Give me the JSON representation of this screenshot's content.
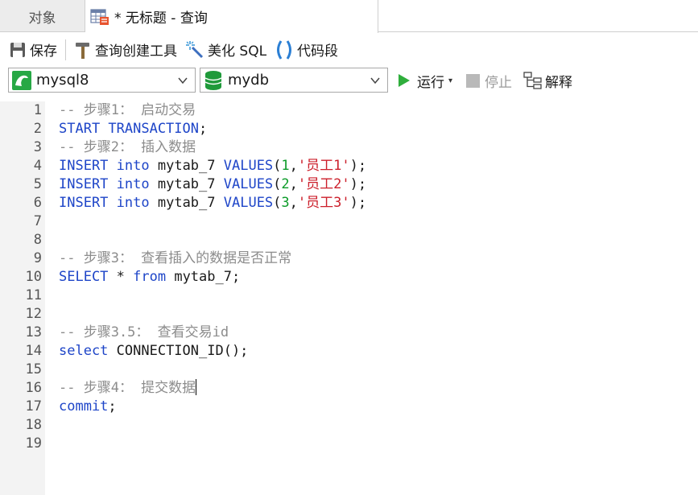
{
  "tabs": {
    "objects_label": "对象",
    "query_label": "* 无标题 - 查询"
  },
  "toolbar": {
    "save_label": "保存",
    "query_builder_label": "查询创建工具",
    "beautify_label": "美化 SQL",
    "snippet_label": "代码段"
  },
  "connection": {
    "selected": "mysql8"
  },
  "database": {
    "selected": "mydb"
  },
  "actions": {
    "run_label": "运行",
    "stop_label": "停止",
    "explain_label": "解释"
  },
  "colors": {
    "keyword": "#1e45c8",
    "comment": "#8c8c8c",
    "number": "#0b9b28",
    "string": "#cc1f2b",
    "run_green": "#2fae3c",
    "db_green": "#1f9a3a"
  },
  "editor": {
    "line_numbers": [
      "1",
      "2",
      "3",
      "4",
      "5",
      "6",
      "7",
      "8",
      "9",
      "10",
      "11",
      "12",
      "13",
      "14",
      "15",
      "16",
      "17",
      "18",
      "19"
    ],
    "lines": [
      [
        {
          "t": "-- 步骤1： 启动交易",
          "k": "comment"
        }
      ],
      [
        {
          "t": "START TRANSACTION",
          "k": "keyword"
        },
        {
          "t": ";",
          "k": "plain"
        }
      ],
      [
        {
          "t": "-- 步骤2： 插入数据",
          "k": "comment"
        }
      ],
      [
        {
          "t": "INSERT",
          "k": "keyword"
        },
        {
          "t": " ",
          "k": "plain"
        },
        {
          "t": "into",
          "k": "keyword"
        },
        {
          "t": " mytab_7 ",
          "k": "plain"
        },
        {
          "t": "VALUES",
          "k": "keyword"
        },
        {
          "t": "(",
          "k": "plain"
        },
        {
          "t": "1",
          "k": "number"
        },
        {
          "t": ",",
          "k": "plain"
        },
        {
          "t": "'员工1'",
          "k": "string"
        },
        {
          "t": ");",
          "k": "plain"
        }
      ],
      [
        {
          "t": "INSERT",
          "k": "keyword"
        },
        {
          "t": " ",
          "k": "plain"
        },
        {
          "t": "into",
          "k": "keyword"
        },
        {
          "t": " mytab_7 ",
          "k": "plain"
        },
        {
          "t": "VALUES",
          "k": "keyword"
        },
        {
          "t": "(",
          "k": "plain"
        },
        {
          "t": "2",
          "k": "number"
        },
        {
          "t": ",",
          "k": "plain"
        },
        {
          "t": "'员工2'",
          "k": "string"
        },
        {
          "t": ");",
          "k": "plain"
        }
      ],
      [
        {
          "t": "INSERT",
          "k": "keyword"
        },
        {
          "t": " ",
          "k": "plain"
        },
        {
          "t": "into",
          "k": "keyword"
        },
        {
          "t": " mytab_7 ",
          "k": "plain"
        },
        {
          "t": "VALUES",
          "k": "keyword"
        },
        {
          "t": "(",
          "k": "plain"
        },
        {
          "t": "3",
          "k": "number"
        },
        {
          "t": ",",
          "k": "plain"
        },
        {
          "t": "'员工3'",
          "k": "string"
        },
        {
          "t": ");",
          "k": "plain"
        }
      ],
      [],
      [],
      [
        {
          "t": "-- 步骤3： 查看插入的数据是否正常",
          "k": "comment"
        }
      ],
      [
        {
          "t": "SELECT",
          "k": "keyword"
        },
        {
          "t": " * ",
          "k": "plain"
        },
        {
          "t": "from",
          "k": "keyword"
        },
        {
          "t": " mytab_7;",
          "k": "plain"
        }
      ],
      [],
      [],
      [
        {
          "t": "-- 步骤3.5： 查看交易id",
          "k": "comment"
        }
      ],
      [
        {
          "t": "select",
          "k": "keyword"
        },
        {
          "t": " CONNECTION_ID();",
          "k": "plain"
        }
      ],
      [],
      [
        {
          "t": "-- 步骤4： 提交数据",
          "k": "comment"
        }
      ],
      [
        {
          "t": "commit",
          "k": "keyword"
        },
        {
          "t": ";",
          "k": "plain"
        }
      ],
      [],
      []
    ]
  }
}
